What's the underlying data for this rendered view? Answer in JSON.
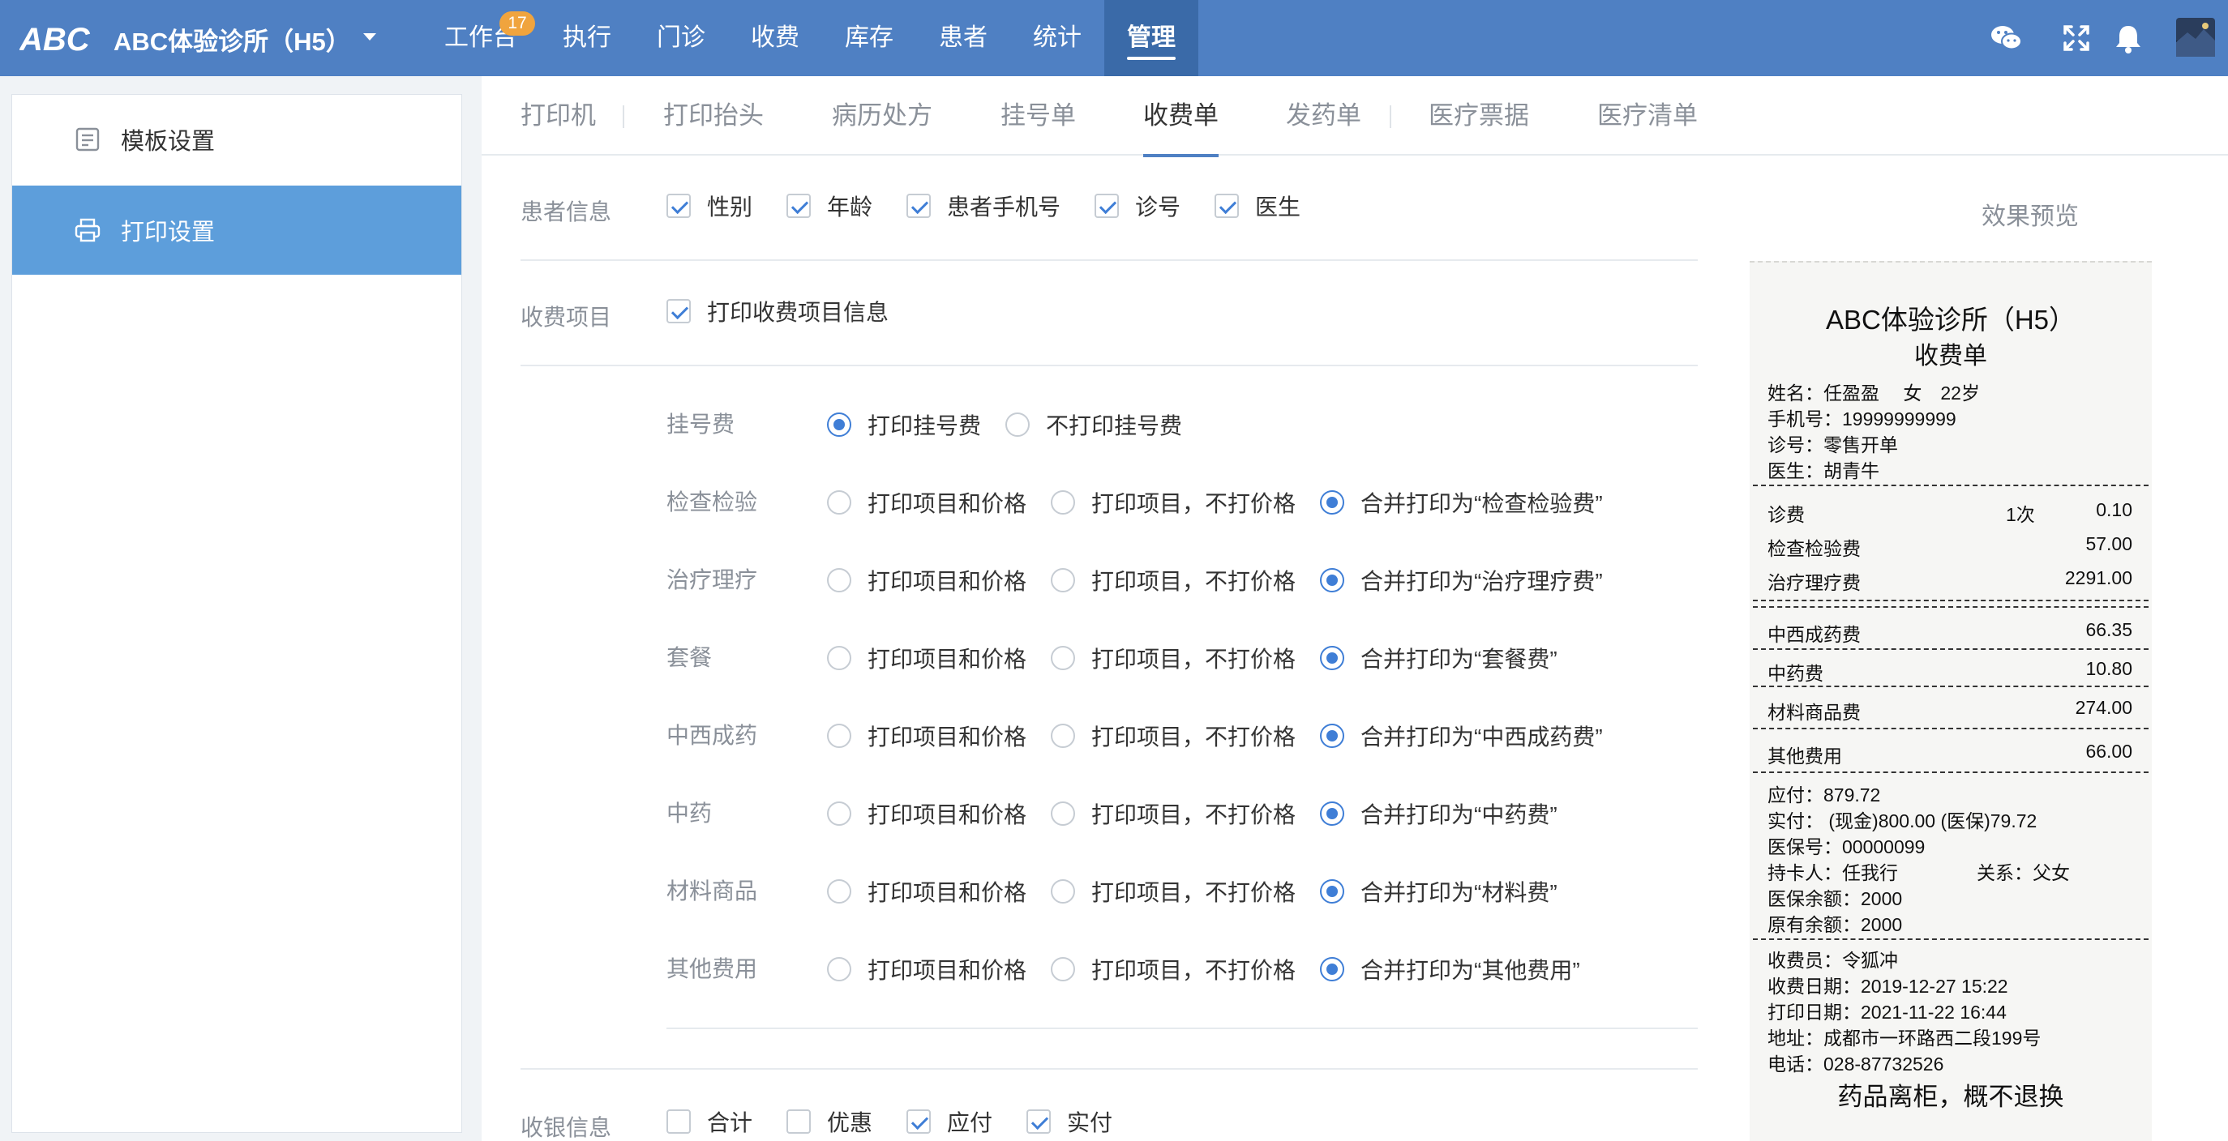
{
  "header": {
    "logo_text": "ABC",
    "clinic_name": "ABC体验诊所（H5）",
    "nav": [
      {
        "label": "工作台",
        "badge": "17"
      },
      {
        "label": "执行"
      },
      {
        "label": "门诊"
      },
      {
        "label": "收费"
      },
      {
        "label": "库存"
      },
      {
        "label": "患者"
      },
      {
        "label": "统计"
      },
      {
        "label": "管理",
        "active": true
      }
    ],
    "icons": [
      "wechat-icon",
      "fullscreen-icon",
      "bell-icon",
      "avatar"
    ]
  },
  "sidebar": {
    "items": [
      {
        "label": "模板设置",
        "icon": "template-icon"
      },
      {
        "label": "打印设置",
        "icon": "printer-icon",
        "active": true
      }
    ]
  },
  "tabs": [
    {
      "label": "打印机"
    },
    {
      "label": "打印抬头"
    },
    {
      "label": "病历处方"
    },
    {
      "label": "挂号单"
    },
    {
      "label": "收费单",
      "active": true
    },
    {
      "label": "发药单"
    },
    {
      "label": "医疗票据"
    },
    {
      "label": "医疗清单"
    }
  ],
  "patient_info": {
    "label": "患者信息",
    "options": [
      {
        "label": "性别",
        "checked": true
      },
      {
        "label": "年龄",
        "checked": true
      },
      {
        "label": "患者手机号",
        "checked": true
      },
      {
        "label": "诊号",
        "checked": true
      },
      {
        "label": "医生",
        "checked": true
      }
    ]
  },
  "charge_items": {
    "label": "收费项目",
    "print_item_info": {
      "label": "打印收费项目信息",
      "checked": true
    },
    "registration": {
      "label": "挂号费",
      "options": [
        {
          "label": "打印挂号费",
          "selected": true
        },
        {
          "label": "不打印挂号费",
          "selected": false
        }
      ]
    },
    "rows": [
      {
        "label": "检查检验",
        "opt1": "打印项目和价格",
        "opt2": "打印项目，不打价格",
        "opt3": "合并打印为“检查检验费”",
        "selected": 3
      },
      {
        "label": "治疗理疗",
        "opt1": "打印项目和价格",
        "opt2": "打印项目，不打价格",
        "opt3": "合并打印为“治疗理疗费”",
        "selected": 3
      },
      {
        "label": "套餐",
        "opt1": "打印项目和价格",
        "opt2": "打印项目，不打价格",
        "opt3": "合并打印为“套餐费”",
        "selected": 3
      },
      {
        "label": "中西成药",
        "opt1": "打印项目和价格",
        "opt2": "打印项目，不打价格",
        "opt3": "合并打印为“中西成药费”",
        "selected": 3
      },
      {
        "label": "中药",
        "opt1": "打印项目和价格",
        "opt2": "打印项目，不打价格",
        "opt3": "合并打印为“中药费”",
        "selected": 3
      },
      {
        "label": "材料商品",
        "opt1": "打印项目和价格",
        "opt2": "打印项目，不打价格",
        "opt3": "合并打印为“材料费”",
        "selected": 3
      },
      {
        "label": "其他费用",
        "opt1": "打印项目和价格",
        "opt2": "打印项目，不打价格",
        "opt3": "合并打印为“其他费用”",
        "selected": 3
      }
    ]
  },
  "cashier_info": {
    "label": "收银信息",
    "options": [
      {
        "label": "合计",
        "checked": false
      },
      {
        "label": "优惠",
        "checked": false
      },
      {
        "label": "应付",
        "checked": true
      },
      {
        "label": "实付",
        "checked": true
      }
    ]
  },
  "preview": {
    "title": "效果预览",
    "receipt": {
      "clinic": "ABC体验诊所（H5）",
      "doc_title": "收费单",
      "name_line": "姓名：任盈盈　 女　22岁",
      "phone": "手机号：19999999999",
      "visit_no": "诊号：零售开单",
      "doctor": "医生：胡青牛",
      "fee_lines": [
        {
          "name": "诊费",
          "qty": "1次",
          "amount": "0.10"
        },
        {
          "name": "检查检验费",
          "qty": "",
          "amount": "57.00"
        },
        {
          "name": "治疗理疗费",
          "qty": "",
          "amount": "2291.00"
        }
      ],
      "group_lines": [
        {
          "name": "中西成药费",
          "amount": "66.35"
        },
        {
          "name": "中药费",
          "amount": "10.80"
        },
        {
          "name": "材料商品费",
          "amount": "274.00"
        },
        {
          "name": "其他费用",
          "amount": "66.00"
        }
      ],
      "payable": "应付：879.72",
      "paid": "实付： (现金)800.00 (医保)79.72",
      "insurance_no": "医保号：00000099",
      "card_holder": "持卡人：任我行",
      "relation": "关系：父女",
      "insurance_balance": "医保余额：2000",
      "original_balance": "原有余额：2000",
      "cashier": "收费员：令狐冲",
      "charge_date": "收费日期：2019-12-27 15:22",
      "print_date": "打印日期：2021-11-22 16:44",
      "address": "地址：成都市一环路西二段199号",
      "tel": "电话：028-87732526",
      "footer": "药品离柜，概不退换"
    }
  }
}
